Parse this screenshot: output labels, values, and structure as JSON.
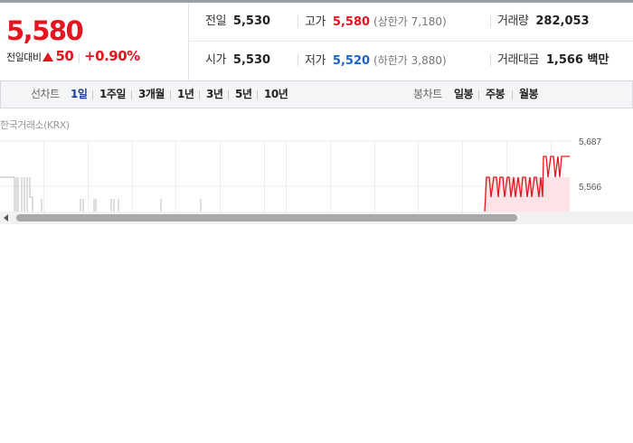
{
  "quote": {
    "price": "5,580",
    "change_label": "전일대비",
    "change_value": "50",
    "change_pct": "+0.90%",
    "stats": {
      "prev_close": {
        "label": "전일",
        "value": "5,530"
      },
      "high": {
        "label": "고가",
        "value": "5,580",
        "sub": "(상한가 7,180)"
      },
      "volume": {
        "label": "거래량",
        "value": "282,053"
      },
      "open": {
        "label": "시가",
        "value": "5,530"
      },
      "low": {
        "label": "저가",
        "value": "5,520",
        "sub": "(하한가 3,880)"
      },
      "amount": {
        "label": "거래대금",
        "value": "1,566 백만"
      }
    }
  },
  "tabs": {
    "line_label": "선차트",
    "line": [
      "1일",
      "1주일",
      "3개월",
      "1년",
      "3년",
      "5년",
      "10년"
    ],
    "candle_label": "봉차트",
    "candle": [
      "일봉",
      "주봉",
      "월봉"
    ],
    "active": "1일"
  },
  "chart": {
    "source": "한국거래소(KRX)",
    "y_labels": [
      "5,687",
      "5,566"
    ],
    "colors": {
      "up": "#e4151f",
      "flat": "#bdbdbd",
      "fill": "#fde3e5"
    }
  },
  "chart_data": {
    "type": "line",
    "title": "",
    "y_ticks": [
      5687,
      5566
    ],
    "series": [
      {
        "values": [
          5566,
          5566,
          5566,
          5566,
          5580,
          5570,
          5580,
          5580,
          5575,
          5580
        ]
      }
    ]
  }
}
